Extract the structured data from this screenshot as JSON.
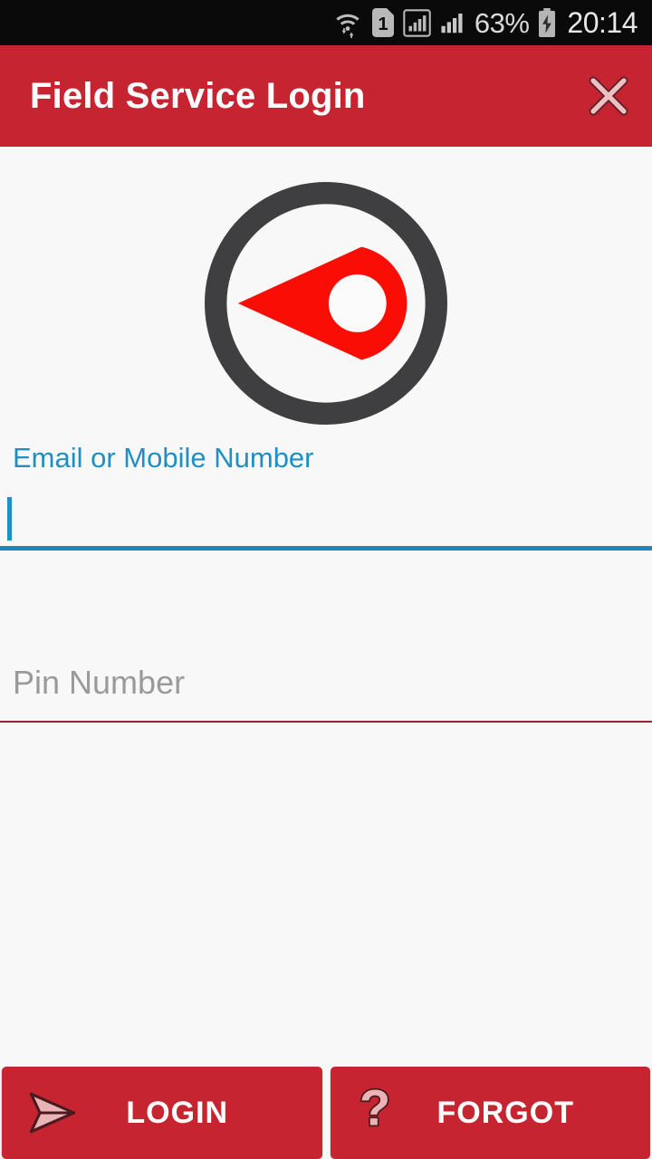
{
  "status_bar": {
    "battery_percent": "63%",
    "clock": "20:14",
    "icons": [
      "wifi-transfer-icon",
      "sim-1-icon",
      "signal-boxed-icon",
      "signal-bars-icon",
      "battery-charging-icon"
    ],
    "sim_label": "1",
    "background": "#0a0a0a",
    "text_color": "#d9d9d9"
  },
  "title_bar": {
    "title": "Field Service Login",
    "close_icon": "close-x-icon",
    "background": "#c62430",
    "title_color": "#ffffff",
    "icon_color": "#eec0c2"
  },
  "logo": {
    "name": "compass-location-pin-logo",
    "ring_color": "#3f3f41",
    "pin_color": "#f90d05",
    "hole_color": "#fbfbfb"
  },
  "form": {
    "email_field": {
      "label": "Email or Mobile Number",
      "value": "",
      "placeholder": "Email or Mobile Number",
      "focused": true,
      "accent_color": "#1b87bd"
    },
    "pin_field": {
      "label": "Pin Number",
      "value": "",
      "placeholder": "Pin Number",
      "focused": false,
      "underline_color": "#98232f",
      "placeholder_color": "#9a9a9a"
    }
  },
  "buttons": {
    "login": {
      "label": "LOGIN",
      "icon": "send-arrow-icon"
    },
    "forgot": {
      "label": "FORGOT",
      "icon": "question-mark-icon"
    },
    "background": "#c62430",
    "label_color": "#ffffff",
    "icon_color": "#eab4b6"
  },
  "page": {
    "background": "#f8f8f8"
  }
}
